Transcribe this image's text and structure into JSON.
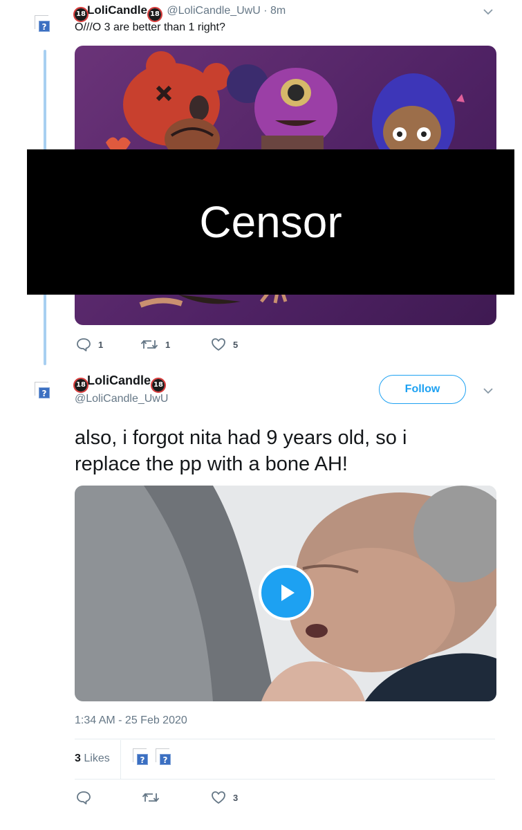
{
  "tweet1": {
    "display_name": "LoliCandle",
    "badge": "18",
    "handle": "@LoliCandle_UwU",
    "separator": "·",
    "time": "8m",
    "text": "O///O 3 are better than 1 right?",
    "censor_label": "Censor",
    "actions": {
      "reply_count": "1",
      "retweet_count": "1",
      "like_count": "5"
    }
  },
  "tweet2": {
    "display_name": "LoliCandle",
    "badge": "18",
    "handle": "@LoliCandle_UwU",
    "follow_label": "Follow",
    "text_line1": "also, i forgot nita had 9 years old, so i",
    "text_line2": "replace the pp with a bone AH!",
    "broken_tag": "/>",
    "timestamp": "1:34 AM - 25 Feb 2020",
    "likes_count": "3",
    "likes_label": "Likes",
    "actions": {
      "like_count": "3"
    }
  },
  "icons": {
    "avatar": "broken-image-icon",
    "more": "chevron-down-icon",
    "reply": "reply-icon",
    "retweet": "retweet-icon",
    "like": "heart-icon",
    "play": "play-icon"
  },
  "colors": {
    "accent": "#1da1f2",
    "thread_line": "#a7cff1",
    "censor_bar": "#000000",
    "image_bg": "#5b2a6e"
  }
}
